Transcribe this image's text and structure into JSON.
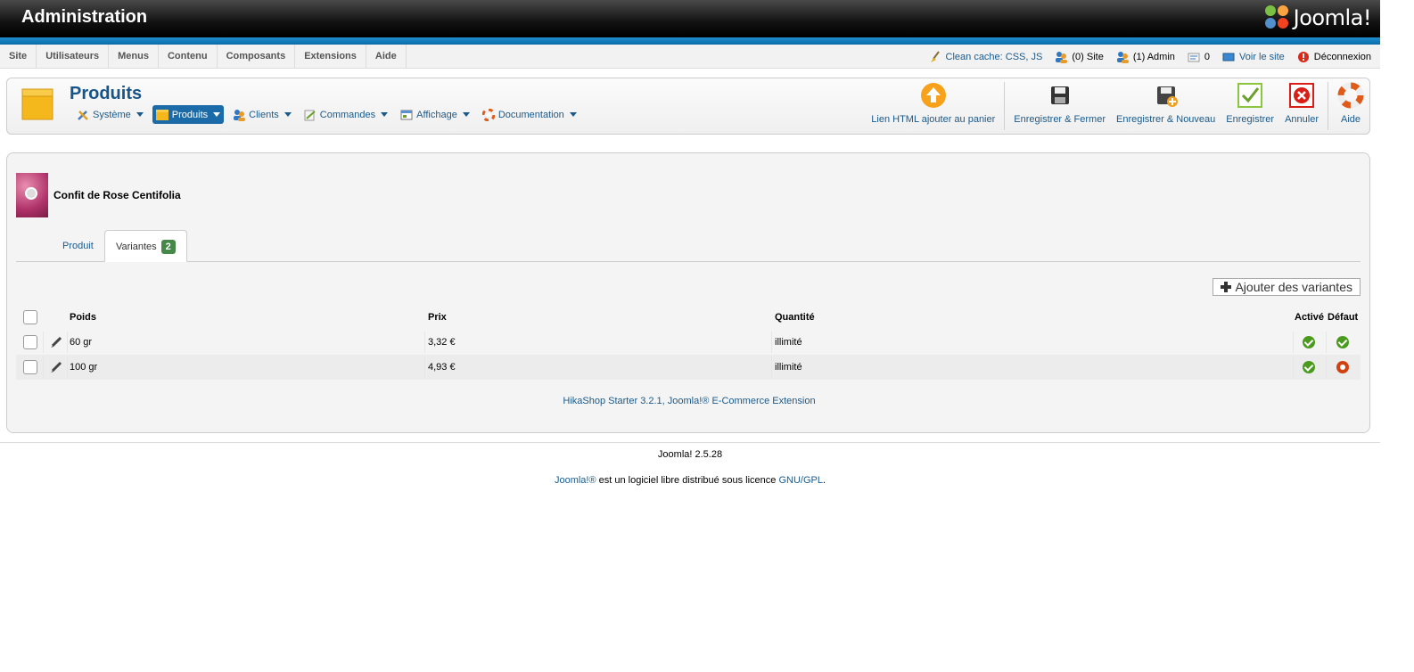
{
  "header": {
    "title": "Administration",
    "logo_text": "Joomla!"
  },
  "menu": {
    "items": [
      "Site",
      "Utilisateurs",
      "Menus",
      "Contenu",
      "Composants",
      "Extensions",
      "Aide"
    ]
  },
  "status": {
    "clean_cache": "Clean cache: CSS, JS",
    "site_users": "(0) Site",
    "admin_users": "(1) Admin",
    "messages": "0",
    "view_site": "Voir le site",
    "logout": "Déconnexion"
  },
  "toolbar": {
    "section_title": "Produits",
    "submenu": [
      {
        "label": "Système",
        "icon": "tools-icon"
      },
      {
        "label": "Produits",
        "icon": "box-icon",
        "active": true
      },
      {
        "label": "Clients",
        "icon": "users-icon"
      },
      {
        "label": "Commandes",
        "icon": "orders-icon"
      },
      {
        "label": "Affichage",
        "icon": "display-icon"
      },
      {
        "label": "Documentation",
        "icon": "lifebuoy-icon"
      }
    ],
    "buttons": {
      "html_link": "Lien HTML ajouter au panier",
      "save_close": "Enregistrer & Fermer",
      "save_new": "Enregistrer & Nouveau",
      "save": "Enregistrer",
      "cancel": "Annuler",
      "help": "Aide"
    }
  },
  "product": {
    "name": "Confit de Rose Centifolia"
  },
  "tabs": {
    "product": "Produit",
    "variants": "Variantes",
    "variants_count": "2"
  },
  "variants": {
    "add_button": "Ajouter des variantes",
    "columns": {
      "weight": "Poids",
      "price": "Prix",
      "quantity": "Quantité",
      "active": "Activé",
      "default": "Défaut"
    },
    "rows": [
      {
        "weight": "60 gr",
        "price": "3,32 €",
        "quantity": "illimité",
        "active": true,
        "default": true
      },
      {
        "weight": "100 gr",
        "price": "4,93 €",
        "quantity": "illimité",
        "active": true,
        "default": false
      }
    ]
  },
  "footer": {
    "credit": "HikaShop Starter 3.2.1, Joomla!® E-Commerce Extension",
    "version": "Joomla! 2.5.28",
    "license_link1": "Joomla!®",
    "license_text": "est un logiciel libre distribué sous licence",
    "license_link2": "GNU/GPL",
    "license_end": "."
  },
  "colors": {
    "link": "#1b5a8c",
    "title": "#16548a",
    "active_tab_bg": "#1b6ba8",
    "badge": "#468847",
    "header_bar": "#1e8fd0"
  }
}
